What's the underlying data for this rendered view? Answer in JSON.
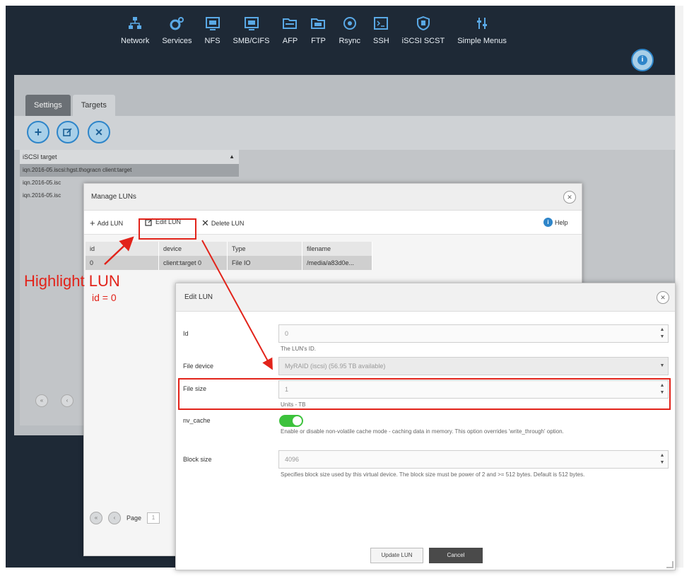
{
  "topnav": [
    {
      "label": "Network",
      "icon": "network-icon"
    },
    {
      "label": "Services",
      "icon": "services-icon"
    },
    {
      "label": "NFS",
      "icon": "nfs-icon"
    },
    {
      "label": "SMB/CIFS",
      "icon": "smb-icon"
    },
    {
      "label": "AFP",
      "icon": "afp-icon"
    },
    {
      "label": "FTP",
      "icon": "ftp-icon"
    },
    {
      "label": "Rsync",
      "icon": "rsync-icon"
    },
    {
      "label": "SSH",
      "icon": "ssh-icon"
    },
    {
      "label": "iSCSI SCST",
      "icon": "iscsi-icon"
    },
    {
      "label": "Simple Menus",
      "icon": "simple-menus-icon"
    }
  ],
  "tabs": [
    {
      "label": "Settings",
      "active": false
    },
    {
      "label": "Targets",
      "active": true
    }
  ],
  "targets_grid": {
    "header": "iSCSI target",
    "rows": [
      "iqn.2016-05.iscsi:hgst.thogracn client:target",
      "iqn.2016-05.isc",
      "iqn.2016-05.isc"
    ]
  },
  "manage_luns": {
    "title": "Manage LUNs",
    "toolbar": {
      "add": "Add LUN",
      "edit": "Edit LUN",
      "delete": "Delete LUN",
      "help": "Help"
    },
    "columns": [
      "id",
      "device",
      "Type",
      "filename"
    ],
    "rows": [
      {
        "id": "0",
        "device": "client:target 0",
        "type": "File IO",
        "filename": "/media/a83d0e..."
      }
    ],
    "pager_label": "Page",
    "page_value": "1"
  },
  "edit_lun": {
    "title": "Edit LUN",
    "fields": {
      "id_label": "Id",
      "id_value": "0",
      "id_hint": "The LUN's ID.",
      "file_device_label": "File device",
      "file_device_value": "MyRAID (iscsi) (56.95 TB available)",
      "file_size_label": "File size",
      "file_size_value": "1",
      "file_size_hint": "Units - TB",
      "nv_cache_label": "nv_cache",
      "nv_cache_on": true,
      "nv_cache_hint": "Enable or disable non-volatile cache mode - caching data in memory. This option overrides 'write_through' option.",
      "block_size_label": "Block size",
      "block_size_value": "4096",
      "block_size_hint": "Specifies block size used by this virtual device. The block size must be power of 2 and >= 512 bytes. Default is 512 bytes."
    },
    "update_button": "Update LUN",
    "cancel_button": "Cancel"
  },
  "annotation": {
    "heading": "Highlight LUN",
    "subtext": "id = 0",
    "color": "#e2231a"
  }
}
